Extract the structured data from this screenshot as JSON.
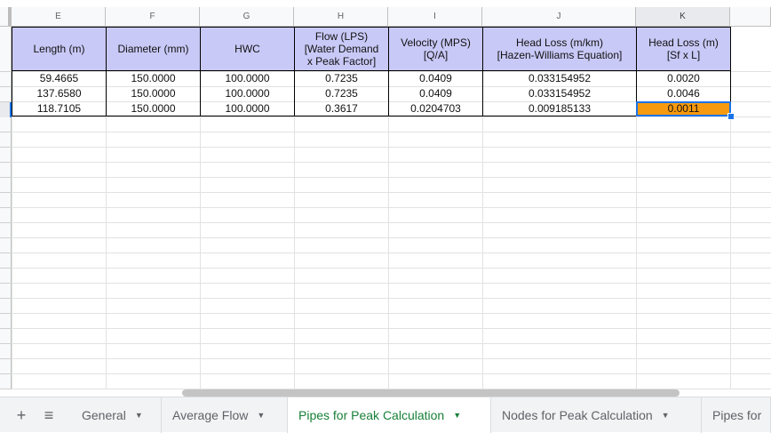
{
  "columns": [
    "E",
    "F",
    "G",
    "H",
    "I",
    "J",
    "K"
  ],
  "headers": [
    [
      "Length (m)"
    ],
    [
      "Diameter (mm)"
    ],
    [
      "HWC"
    ],
    [
      "Flow (LPS)",
      "[Water Demand",
      "x Peak Factor]"
    ],
    [
      "Velocity (MPS)",
      "[Q/A]"
    ],
    [
      "Head Loss (m/km)",
      "[Hazen-Williams Equation]"
    ],
    [
      "Head Loss (m)",
      "[Sf x L]"
    ]
  ],
  "rows": [
    [
      "59.4665",
      "150.0000",
      "100.0000",
      "0.7235",
      "0.0409",
      "0.033154952",
      "0.0020"
    ],
    [
      "137.6580",
      "150.0000",
      "100.0000",
      "0.7235",
      "0.0409",
      "0.033154952",
      "0.0046"
    ],
    [
      "118.7105",
      "150.0000",
      "100.0000",
      "0.3617",
      "0.0204703",
      "0.009185133",
      "0.0011"
    ]
  ],
  "selected_cell": {
    "row": 2,
    "col": 6
  },
  "tabs": [
    {
      "label": "General",
      "active": false
    },
    {
      "label": "Average Flow",
      "active": false
    },
    {
      "label": "Pipes for Peak Calculation",
      "active": true
    },
    {
      "label": "Nodes for Peak Calculation",
      "active": false
    },
    {
      "label": "Pipes for",
      "active": false
    }
  ],
  "toolbar": {
    "add_sheet": "+",
    "all_sheets": "≡"
  },
  "colors": {
    "header_fill": "#c9c9f8",
    "selected_fill": "#f89a0f",
    "active_tab": "#188038",
    "selection": "#1a73e8"
  }
}
